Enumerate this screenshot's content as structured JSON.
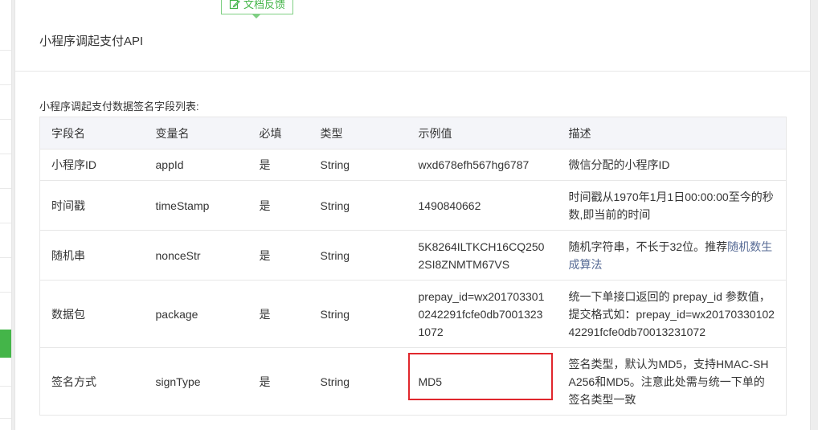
{
  "page": {
    "title": "小程序调起支付API",
    "feedback_label": "文档反馈",
    "caption": "小程序调起支付数据签名字段列表:"
  },
  "table": {
    "headers": [
      "字段名",
      "变量名",
      "必填",
      "类型",
      "示例值",
      "描述"
    ],
    "rows": [
      {
        "field": "小程序ID",
        "var": "appId",
        "required": "是",
        "type": "String",
        "example": "wxd678efh567hg6787",
        "desc": "微信分配的小程序ID",
        "desc_link": ""
      },
      {
        "field": "时间戳",
        "var": "timeStamp",
        "required": "是",
        "type": "String",
        "example": "1490840662",
        "desc": "时间戳从1970年1月1日00:00:00至今的秒数,即当前的时间",
        "desc_link": ""
      },
      {
        "field": "随机串",
        "var": "nonceStr",
        "required": "是",
        "type": "String",
        "example": "5K8264ILTKCH16CQ2502SI8ZNMTM67VS",
        "desc": "随机字符串，不长于32位。推荐",
        "desc_link": "随机数生成算法"
      },
      {
        "field": "数据包",
        "var": "package",
        "required": "是",
        "type": "String",
        "example": "prepay_id=wx2017033010242291fcfe0db70013231072",
        "desc": "统一下单接口返回的 prepay_id 参数值，提交格式如：prepay_id=wx2017033010242291fcfe0db70013231072",
        "desc_link": ""
      },
      {
        "field": "签名方式",
        "var": "signType",
        "required": "是",
        "type": "String",
        "example": "MD5",
        "desc": "签名类型，默认为MD5，支持HMAC-SHA256和MD5。注意此处需与统一下单的签名类型一致",
        "desc_link": ""
      }
    ]
  },
  "colors": {
    "accent_green": "#44b549",
    "link": "#576b95",
    "highlight_red": "#e0272d"
  },
  "icons": {
    "feedback": "edit-icon"
  }
}
